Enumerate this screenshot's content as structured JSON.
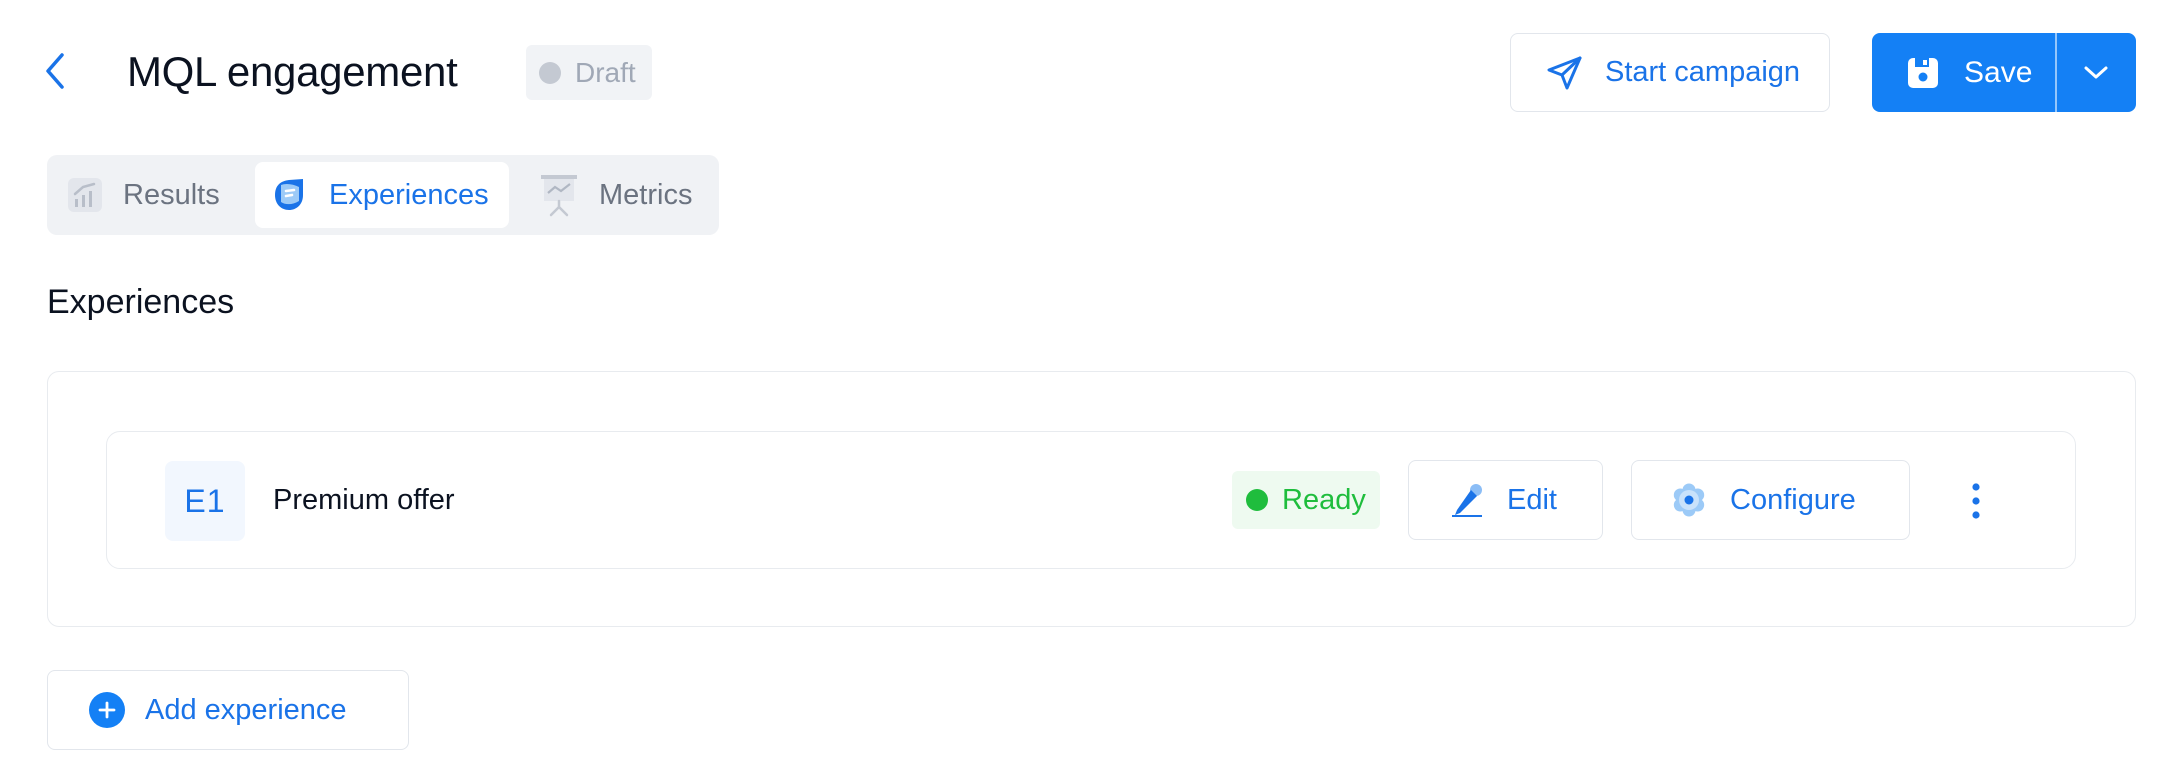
{
  "header": {
    "title": "MQL engagement",
    "status": "Draft",
    "start_campaign_label": "Start campaign",
    "save_label": "Save"
  },
  "tabs": [
    {
      "label": "Results",
      "icon": "chart-icon",
      "active": false
    },
    {
      "label": "Experiences",
      "icon": "experiences-icon",
      "active": true
    },
    {
      "label": "Metrics",
      "icon": "presentation-icon",
      "active": false
    }
  ],
  "section_title": "Experiences",
  "experiences": [
    {
      "code": "E1",
      "name": "Premium offer",
      "status": "Ready",
      "edit_label": "Edit",
      "configure_label": "Configure"
    }
  ],
  "add_experience_label": "Add experience",
  "colors": {
    "accent": "#1480f5",
    "link": "#1a73e8",
    "ready": "#1fbd3d",
    "draft": "#a0a8b6"
  }
}
